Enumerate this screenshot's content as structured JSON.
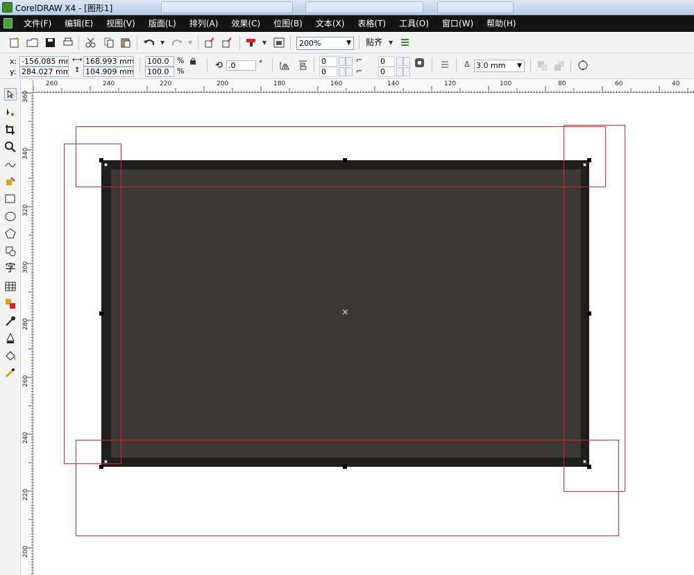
{
  "window": {
    "title": "CorelDRAW X4 - [图形1]"
  },
  "menu": {
    "items": [
      "文件(F)",
      "编辑(E)",
      "视图(V)",
      "版面(L)",
      "排列(A)",
      "效果(C)",
      "位图(B)",
      "文本(X)",
      "表格(T)",
      "工具(O)",
      "窗口(W)",
      "帮助(H)"
    ]
  },
  "standard_toolbar": {
    "zoom": "200%",
    "snap_label": "贴齐"
  },
  "property_bar": {
    "x_label": "x:",
    "y_label": "y:",
    "x_value": "-156.085 mm",
    "y_value": "284.027 mm",
    "width_value": "168.993 mm",
    "height_value": "104.909 mm",
    "scale_x": "100.0",
    "scale_y": "100.0",
    "percent": "%",
    "rotation": ".0",
    "degree": "°",
    "corner_1": "0",
    "corner_2": "0",
    "corner_3": "0",
    "corner_4": "0",
    "outline_width": "3.0 mm"
  },
  "rulers": {
    "horizontal": [
      "260",
      "240",
      "220",
      "200",
      "180",
      "160",
      "140",
      "120",
      "100",
      "80",
      "60",
      "40"
    ],
    "vertical": [
      "360",
      "340",
      "320",
      "300",
      "280",
      "260",
      "240",
      "220",
      "200"
    ]
  },
  "colors": {
    "rect_outline": "#201e1c",
    "rect_fill": "#3b3734",
    "annotation": "#e0262a"
  }
}
